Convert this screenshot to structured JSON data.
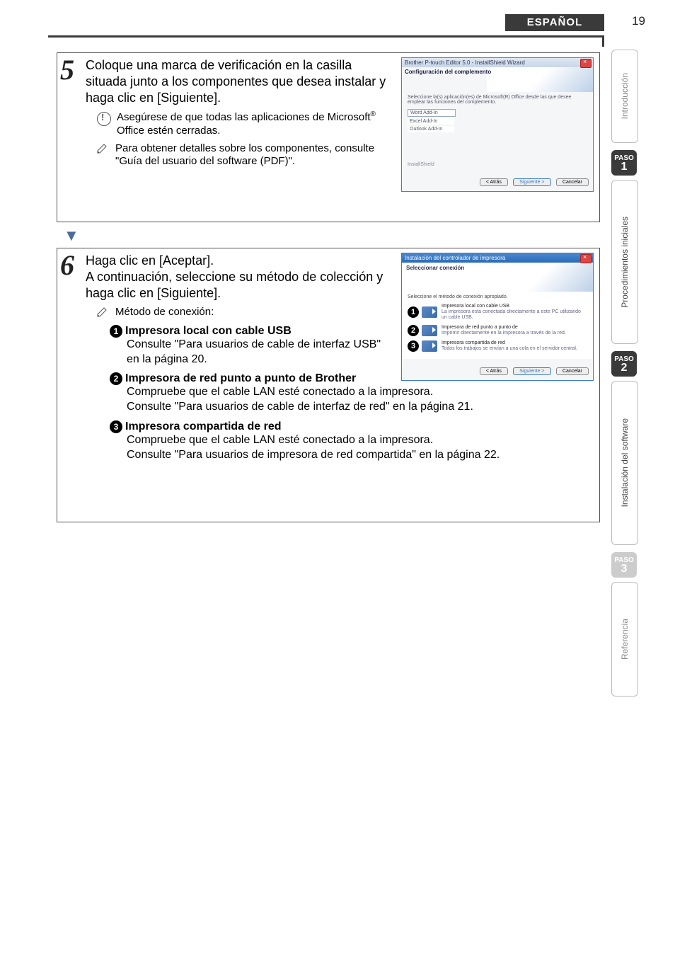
{
  "header": {
    "lang": "ESPAÑOL",
    "page": "19"
  },
  "tabs": {
    "intro": "Introducción",
    "paso1": {
      "label": "PASO",
      "num": "1"
    },
    "proc": "Procedimientos iniciales",
    "paso2": {
      "label": "PASO",
      "num": "2"
    },
    "inst": "Instalación del software",
    "paso3": {
      "label": "PASO",
      "num": "3"
    },
    "ref": "Referencia"
  },
  "step5": {
    "num": "5",
    "text": "Coloque una marca de verificación en la casilla situada junto a los componentes que desea instalar y haga clic en [Siguiente].",
    "note1a": "Asegúrese de que todas las aplicaciones de Microsoft",
    "note1b": " Office estén cerradas.",
    "reg": "®",
    "note2": "Para obtener detalles sobre los componentes, consulte \"Guía del usuario del software (PDF)\".",
    "ss": {
      "title": "Brother P-touch Editor 5.0 - InstallShield Wizard",
      "subtitle": "Configuración del complemento",
      "desc": "Seleccione la(s) aplicación(es) de Microsoft(R) Office desde las que desee emplear las funciones del complemento.",
      "opt1": "Word Add-In",
      "opt2": "Excel Add-In",
      "opt3": "Outlook Add-In",
      "group": "InstallShield",
      "btn_back": "< Atrás",
      "btn_next": "Siguiente >",
      "btn_cancel": "Cancelar"
    }
  },
  "step6": {
    "num": "6",
    "line1": "Haga clic en [Aceptar].",
    "line2": "A continuación, seleccione su método de colección y haga clic en [Siguiente].",
    "note_label": "Método de conexión:",
    "m1_title": "Impresora local con cable USB",
    "m1_body": "Consulte \"Para usuarios de cable de interfaz USB\" en la página 20.",
    "m2_title": "Impresora de red punto a punto de Brother",
    "m2_body1": "Compruebe que el cable LAN esté conectado a la impresora.",
    "m2_body2": "Consulte \"Para usuarios de cable de interfaz de red\" en la página 21.",
    "m3_title": "Impresora compartida de red",
    "m3_body1": "Compruebe que el cable LAN esté conectado a la impresora.",
    "m3_body2": "Consulte \"Para usuarios de impresora de red compartida\" en la página 22.",
    "ss": {
      "title": "Instalación del controlador de impresora",
      "subtitle": "Seleccionar conexión",
      "desc": "Seleccione el método de conexión apropiado.",
      "o1a": "Impresora local con cable USB",
      "o1b": "La impresora está conectada directamente a este PC utilizando un cable USB.",
      "o2a": "Impresora de red punto a punto de",
      "o2b": "Imprimir directamente en la impresora a través de la red.",
      "o3a": "Impresora compartida de red",
      "o3b": "Todos los trabajos se envían a una cola en el servidor central.",
      "btn_back": "< Atrás",
      "btn_next": "Siguiente >",
      "btn_cancel": "Cancelar"
    }
  }
}
